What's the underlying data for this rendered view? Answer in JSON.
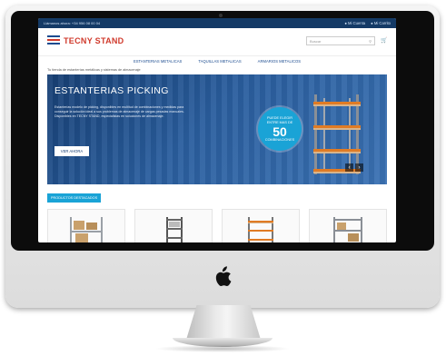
{
  "topbar": {
    "phone": "Llámanos ahora: +34 956 08 00 04",
    "account_1": "Mi Cuenta",
    "account_2": "Mi Carrito"
  },
  "header": {
    "brand": "TECNY STAND",
    "search_placeholder": "Buscar"
  },
  "nav": {
    "items": [
      "ESTANTERIAS METALICAS",
      "TAQUILLAS METALICAS",
      "ARMARIOS METALICOS"
    ]
  },
  "tagline": "Tu tienda de estanterías metálicas y sistemas de almacenaje",
  "hero": {
    "title": "ESTANTERIAS PICKING",
    "text": "Estanterías modelo de picking, disponibles en multitud de combinaciones y medidas para conseguir la solución ideal a sus problemas de almacenaje de cargas pesadas manuales. Disponibles en TECNY STAND, especialistas en soluciones de almacenaje.",
    "cta": "VER AHORA",
    "badge_line1": "PUEDE ELEGIR",
    "badge_line2": "ENTRE MAS DE",
    "badge_number": "50",
    "badge_line3": "COMBINACIONES",
    "prev": "‹",
    "next": "›"
  },
  "featured": {
    "label": "PRODUCTOS DESTACADOS"
  },
  "colors": {
    "navy": "#143a66",
    "brand_red": "#d0392b",
    "accent": "#1aa3d6"
  },
  "icons": {
    "search": "search-icon",
    "cart": "cart-icon",
    "apple_logo": "apple-logo-icon"
  }
}
